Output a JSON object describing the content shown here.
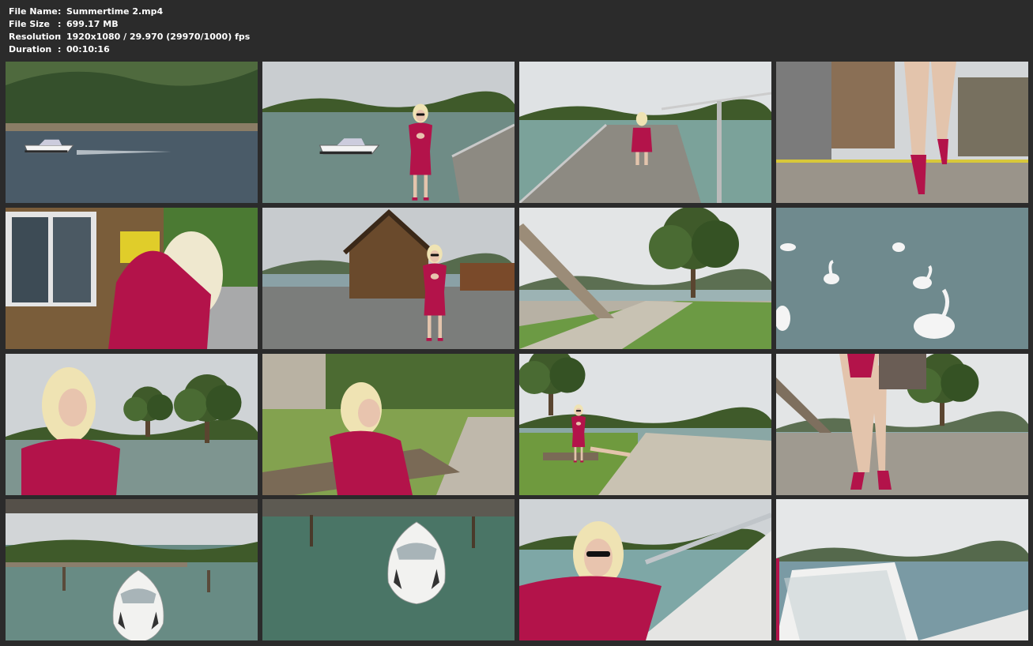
{
  "info": [
    {
      "key": "File Name",
      "sep": ":",
      "value": "Summertime 2.mp4"
    },
    {
      "key": "File Size",
      "sep": ":",
      "value": "699.17 MB"
    },
    {
      "key": "Resolution",
      "sep": ":",
      "value": "1920x1080 / 29.970 (29970/1000) fps"
    },
    {
      "key": "Duration",
      "sep": ":",
      "value": "00:10:16"
    }
  ],
  "colors": {
    "background": "#2b2b2b",
    "text": "#ffffff",
    "dress": "#b3134a",
    "lake": "#6f8c86",
    "sky": "#d7dadd",
    "trees": "#3f5a2a"
  },
  "thumbnails": [
    {
      "scene": "speedboat-on-lake"
    },
    {
      "scene": "woman-on-pier-with-boat"
    },
    {
      "scene": "woman-crouching-on-pier"
    },
    {
      "scene": "legs-walking-on-pier"
    },
    {
      "scene": "woman-at-kiosk"
    },
    {
      "scene": "woman-by-boathouse"
    },
    {
      "scene": "stairs-and-tree-lakeside"
    },
    {
      "scene": "swans-in-water"
    },
    {
      "scene": "woman-portrait-lakeside"
    },
    {
      "scene": "woman-on-bench"
    },
    {
      "scene": "woman-on-bench-wide"
    },
    {
      "scene": "legs-walking-on-path"
    },
    {
      "scene": "boat-at-dock"
    },
    {
      "scene": "boat-from-above"
    },
    {
      "scene": "woman-in-boat"
    },
    {
      "scene": "boat-windshield-view"
    }
  ]
}
